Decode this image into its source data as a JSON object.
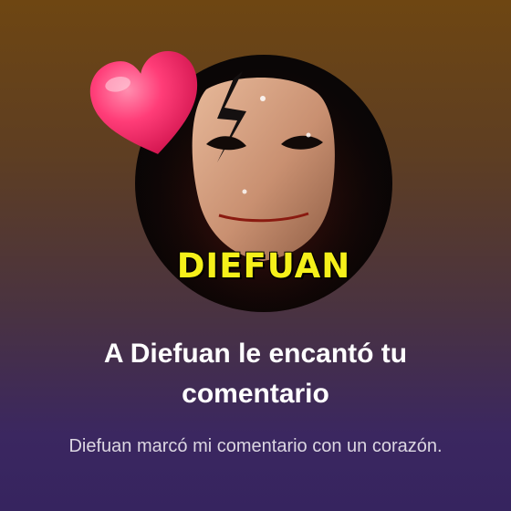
{
  "notification": {
    "avatar_label": "DIEFUAN",
    "reaction_icon": "heart-icon",
    "title": "A Diefuan le encantó tu comentario",
    "subtitle": "Diefuan marcó mi comentario con un corazón."
  },
  "colors": {
    "background_top": "#6e4612",
    "background_bottom": "#36245f",
    "title_text": "#ffffff",
    "subtitle_text": "#dcd7e2",
    "heart": "#ff2f6e",
    "avatar_label_text": "#f5f01a"
  }
}
